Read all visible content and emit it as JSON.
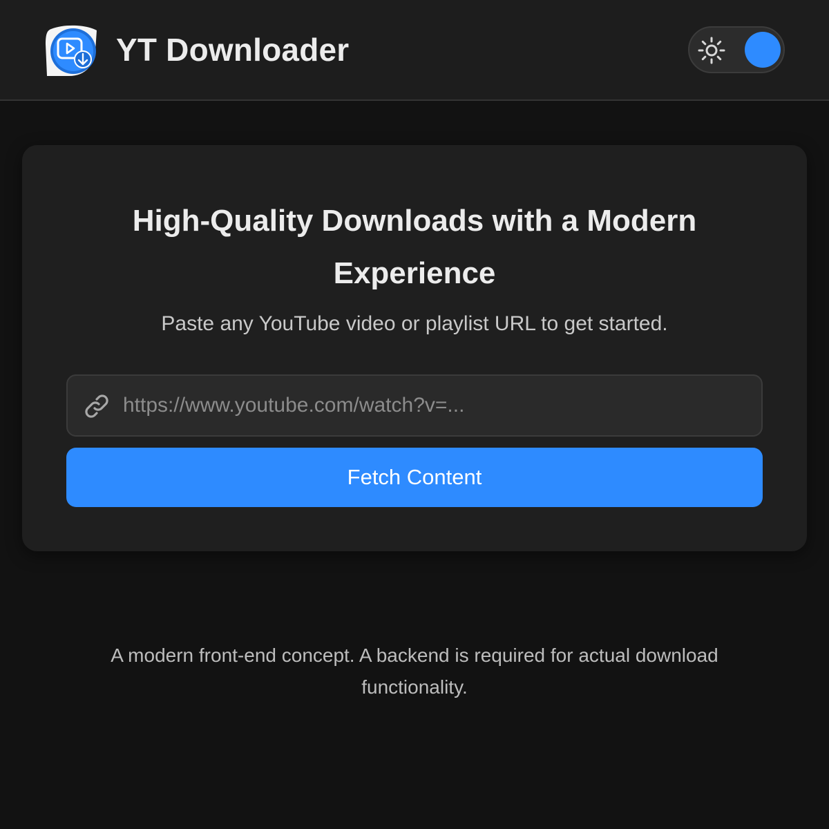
{
  "header": {
    "logo_icon": "video-download-logo-icon",
    "title": "YT Downloader",
    "theme_toggle": {
      "icon": "sun-icon",
      "state": "dark"
    }
  },
  "hero": {
    "headline": "High-Quality Downloads with a Modern Experience",
    "subtitle": "Paste any YouTube video or playlist URL to get started."
  },
  "url_input": {
    "icon": "link-icon",
    "value": "",
    "placeholder": "https://www.youtube.com/watch?v=..."
  },
  "fetch_button": {
    "label": "Fetch Content"
  },
  "footer": {
    "note": "A modern front-end concept. A backend is required for actual download functionality."
  },
  "colors": {
    "accent": "#2e8bff",
    "background": "#121212",
    "header_bg": "#1d1d1d",
    "card_bg": "#1f1f1f",
    "input_bg": "#2a2a2a"
  }
}
